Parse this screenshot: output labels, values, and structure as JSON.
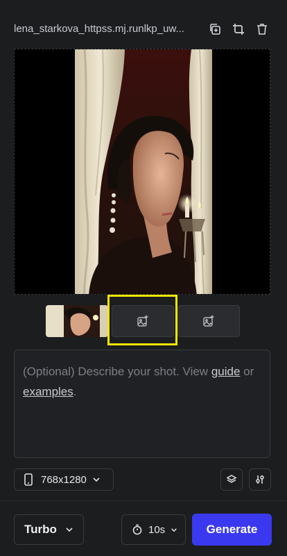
{
  "header": {
    "filename": "lena_starkova_httpss.mj.runlkp_uw..."
  },
  "preview": {
    "image_icon": "generated-portrait-image"
  },
  "thumbnails": [
    {
      "kind": "image",
      "icon": "thumbnail-image"
    },
    {
      "kind": "empty",
      "icon": "add-image-icon"
    },
    {
      "kind": "empty",
      "icon": "add-image-icon"
    }
  ],
  "prompt": {
    "text_before": "(Optional) Describe your shot. View ",
    "guide_link": "guide",
    "text_middle": " or ",
    "examples_link": "examples",
    "text_after": "."
  },
  "controls": {
    "resolution": "768x1280"
  },
  "footer": {
    "mode": "Turbo",
    "duration": "10s",
    "generate": "Generate"
  },
  "colors": {
    "accent": "#3b39f0",
    "highlight": "#f2e600",
    "background": "#1c1d1f"
  }
}
